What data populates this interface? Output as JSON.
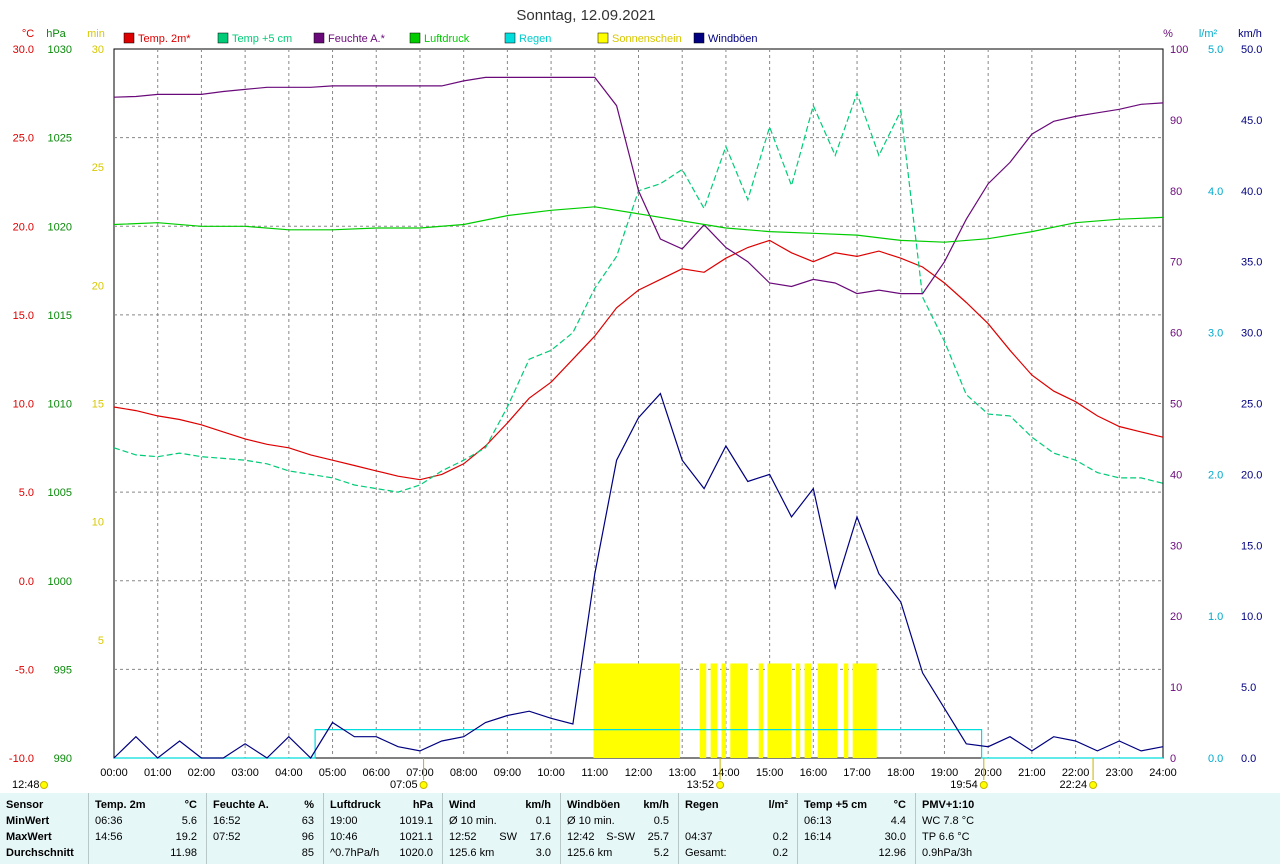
{
  "title": "Sonntag, 12.09.2021",
  "colors": {
    "temp2m": "#dd0000",
    "temp5cm": "#00cc77",
    "feuchte": "#6a0a7a",
    "luftdruck": "#00cc00",
    "regen": "#00dddd",
    "sonne": "#ffff00",
    "wind": "#000080",
    "grid": "#888888",
    "footer_bg": "#e6f7f8"
  },
  "legend": [
    {
      "key": "temp2m",
      "label": "Temp. 2m*"
    },
    {
      "key": "temp5cm",
      "label": "Temp +5 cm"
    },
    {
      "key": "feuchte",
      "label": "Feuchte A.*"
    },
    {
      "key": "luftdruck",
      "label": "Luftdruck"
    },
    {
      "key": "regen",
      "label": "Regen"
    },
    {
      "key": "sonne",
      "label": "Sonnenschein"
    },
    {
      "key": "wind",
      "label": "Windböen"
    }
  ],
  "axis_units": {
    "temp": "°C",
    "press": "hPa",
    "sun": "min",
    "hum": "%",
    "rain": "l/m²",
    "wind": "km/h"
  },
  "chart_data": {
    "type": "line",
    "title": "Sonntag, 12.09.2021",
    "xlim": [
      0,
      24
    ],
    "x_ticks": [
      "00:00",
      "01:00",
      "02:00",
      "03:00",
      "04:00",
      "05:00",
      "06:00",
      "07:00",
      "08:00",
      "09:00",
      "10:00",
      "11:00",
      "12:00",
      "13:00",
      "14:00",
      "15:00",
      "16:00",
      "17:00",
      "18:00",
      "19:00",
      "20:00",
      "21:00",
      "22:00",
      "23:00",
      "24:00"
    ],
    "grid": true,
    "axes": {
      "temp": {
        "ylim": [
          -10,
          30
        ],
        "ticks": [
          "30.0",
          "25.0",
          "20.0",
          "15.0",
          "10.0",
          "5.0",
          "0.0",
          "-5.0",
          "-10.0"
        ]
      },
      "press": {
        "ylim": [
          990,
          1030
        ],
        "ticks": [
          "1030",
          "1025",
          "1020",
          "1015",
          "1010",
          "1005",
          "1000",
          "995",
          "990"
        ]
      },
      "sun": {
        "ylim": [
          0,
          30
        ],
        "ticks": [
          "30",
          "25",
          "20",
          "15",
          "10",
          "5"
        ]
      },
      "hum": {
        "ylim": [
          0,
          100
        ],
        "ticks": [
          "100",
          "90",
          "80",
          "70",
          "60",
          "50",
          "40",
          "30",
          "20",
          "10",
          "0"
        ]
      },
      "rain": {
        "ylim": [
          0,
          5
        ],
        "ticks": [
          "5.0",
          "4.0",
          "3.0",
          "2.0",
          "1.0",
          "0.0"
        ]
      },
      "wind": {
        "ylim": [
          0,
          50
        ],
        "ticks": [
          "50.0",
          "45.0",
          "40.0",
          "35.0",
          "30.0",
          "25.0",
          "20.0",
          "15.0",
          "10.0",
          "5.0",
          "0.0"
        ]
      }
    },
    "series": [
      {
        "name": "Temp. 2m*",
        "axis": "temp",
        "x": [
          0,
          0.5,
          1,
          1.5,
          2,
          2.5,
          3,
          3.5,
          4,
          4.5,
          5,
          5.5,
          6,
          6.5,
          7,
          7.5,
          8,
          8.5,
          9,
          9.5,
          10,
          10.5,
          11,
          11.5,
          12,
          12.5,
          13,
          13.5,
          14,
          14.5,
          15,
          15.5,
          16,
          16.5,
          17,
          17.5,
          18,
          18.5,
          19,
          19.5,
          20,
          20.5,
          21,
          21.5,
          22,
          22.5,
          23,
          23.5,
          24
        ],
        "y": [
          9.8,
          9.6,
          9.3,
          9.1,
          8.8,
          8.4,
          8.0,
          7.7,
          7.5,
          7.1,
          6.8,
          6.5,
          6.2,
          5.9,
          5.7,
          6.0,
          6.6,
          7.6,
          8.9,
          10.3,
          11.2,
          12.5,
          13.8,
          15.4,
          16.4,
          17.0,
          17.6,
          17.4,
          18.2,
          18.8,
          19.2,
          18.5,
          18.0,
          18.5,
          18.3,
          18.6,
          18.2,
          17.7,
          16.8,
          15.7,
          14.5,
          13.0,
          11.6,
          10.7,
          10.1,
          9.3,
          8.7,
          8.4,
          8.1
        ]
      },
      {
        "name": "Temp +5 cm",
        "axis": "temp",
        "x": [
          0,
          0.5,
          1,
          1.5,
          2,
          2.5,
          3,
          3.5,
          4,
          4.5,
          5,
          5.5,
          6,
          6.5,
          7,
          7.5,
          8,
          8.5,
          9,
          9.5,
          10,
          10.5,
          11,
          11.5,
          12,
          12.5,
          13,
          13.5,
          14,
          14.5,
          15,
          15.5,
          16,
          16.5,
          17,
          17.5,
          18,
          18.5,
          19,
          19.5,
          20,
          20.5,
          21,
          21.5,
          22,
          22.5,
          23,
          23.5,
          24
        ],
        "y": [
          7.5,
          7.1,
          7.0,
          7.2,
          7.0,
          6.9,
          6.8,
          6.6,
          6.2,
          6.0,
          5.8,
          5.4,
          5.2,
          5.0,
          5.4,
          6.2,
          6.8,
          7.5,
          9.8,
          12.5,
          13.0,
          14.0,
          16.5,
          18.3,
          22.0,
          22.4,
          23.2,
          21.0,
          24.5,
          21.5,
          25.6,
          22.3,
          26.8,
          24.0,
          27.5,
          24.0,
          26.5,
          16.0,
          13.5,
          10.5,
          9.4,
          9.3,
          8.1,
          7.2,
          6.8,
          6.1,
          5.8,
          5.8,
          5.5
        ]
      },
      {
        "name": "Feuchte A.*",
        "axis": "hum",
        "x": [
          0,
          0.5,
          1,
          1.5,
          2,
          2.5,
          3,
          3.5,
          4,
          4.5,
          5,
          5.5,
          6,
          6.5,
          7,
          7.5,
          8,
          8.5,
          9,
          9.5,
          10,
          10.5,
          11,
          11.5,
          12,
          12.5,
          13,
          13.5,
          14,
          14.5,
          15,
          15.5,
          16,
          16.5,
          17,
          17.5,
          18,
          18.5,
          19,
          19.5,
          20,
          20.5,
          21,
          21.5,
          22,
          22.5,
          23,
          23.5,
          24
        ],
        "y": [
          93.2,
          93.3,
          93.6,
          93.6,
          93.6,
          94.0,
          94.3,
          94.6,
          94.6,
          94.6,
          94.8,
          94.8,
          94.8,
          94.8,
          94.8,
          94.8,
          95.5,
          96.0,
          96.0,
          96.0,
          96.0,
          96.0,
          96.0,
          92.0,
          80.0,
          73.2,
          71.8,
          75.2,
          72.0,
          70.0,
          67.0,
          66.5,
          67.5,
          67.0,
          65.5,
          66.0,
          65.5,
          65.5,
          70.0,
          76.0,
          81.0,
          84.0,
          88.0,
          89.8,
          90.5,
          91.0,
          91.5,
          92.2,
          92.4
        ]
      },
      {
        "name": "Luftdruck",
        "axis": "press",
        "x": [
          0,
          1,
          2,
          3,
          4,
          5,
          6,
          7,
          8,
          9,
          10,
          11,
          12,
          13,
          14,
          15,
          16,
          17,
          18,
          19,
          20,
          21,
          22,
          23,
          24
        ],
        "y": [
          1020.1,
          1020.2,
          1020.0,
          1020.0,
          1019.8,
          1019.8,
          1019.9,
          1019.9,
          1020.1,
          1020.6,
          1020.9,
          1021.1,
          1020.7,
          1020.3,
          1019.9,
          1019.7,
          1019.6,
          1019.5,
          1019.2,
          1019.1,
          1019.3,
          1019.7,
          1020.2,
          1020.4,
          1020.5
        ]
      },
      {
        "name": "Regen",
        "axis": "rain",
        "x": [
          0,
          4.6,
          4.6,
          19.85,
          19.85,
          24
        ],
        "y": [
          0,
          0,
          0.2,
          0.2,
          0,
          0
        ]
      },
      {
        "name": "Windböen",
        "axis": "wind",
        "x": [
          0,
          0.5,
          1,
          1.5,
          2,
          2.5,
          3,
          3.5,
          4,
          4.5,
          5,
          5.5,
          6,
          6.5,
          7,
          7.5,
          8,
          8.5,
          9,
          9.5,
          10,
          10.5,
          11,
          11.5,
          12,
          12.5,
          13,
          13.5,
          14,
          14.5,
          15,
          15.5,
          16,
          16.5,
          17,
          17.5,
          18,
          18.5,
          19,
          19.5,
          20,
          20.5,
          21,
          21.5,
          22,
          22.5,
          23,
          23.5,
          24
        ],
        "y": [
          0,
          1.5,
          0,
          1.2,
          0,
          0,
          1,
          0,
          1.5,
          0,
          2.5,
          1.5,
          1.5,
          0.8,
          0.5,
          1.2,
          1.5,
          2.5,
          3,
          3.3,
          2.8,
          2.4,
          13,
          21,
          24,
          25.7,
          21,
          19,
          22,
          19.5,
          20,
          17,
          19,
          12,
          17,
          13,
          11,
          6,
          3.5,
          1,
          0.8,
          1.5,
          0.5,
          1.5,
          1.2,
          0.5,
          1.2,
          0.5,
          0.8
        ]
      }
    ],
    "sunshine_intervals": [
      [
        10.97,
        12.95
      ],
      [
        13.4,
        13.55
      ],
      [
        13.65,
        13.8
      ],
      [
        13.9,
        14.0
      ],
      [
        14.1,
        14.5
      ],
      [
        14.75,
        14.85
      ],
      [
        14.95,
        15.5
      ],
      [
        15.6,
        15.7
      ],
      [
        15.8,
        15.95
      ],
      [
        16.1,
        16.55
      ],
      [
        16.7,
        16.8
      ],
      [
        16.9,
        17.45
      ]
    ],
    "markers": [
      {
        "label": "07:05",
        "x": 7.083
      },
      {
        "label": "13:52",
        "x": 13.867
      },
      {
        "label": "19:54",
        "x": 19.9
      },
      {
        "label": "22:24",
        "x": 22.4
      },
      {
        "label": "12:48",
        "x": 12.8
      }
    ]
  },
  "footer": {
    "columns": [
      {
        "head": "Sensor",
        "unit": "",
        "rows": [
          [
            "MinWert",
            "",
            ""
          ],
          [
            "MaxWert",
            "",
            ""
          ],
          [
            "Durchschnitt",
            "",
            ""
          ]
        ]
      },
      {
        "head": "Temp. 2m",
        "unit": "°C",
        "rows": [
          [
            "06:36",
            "",
            "5.6"
          ],
          [
            "14:56",
            "",
            "19.2"
          ],
          [
            "",
            "",
            "11.98"
          ]
        ]
      },
      {
        "head": "Feuchte A.",
        "unit": "%",
        "rows": [
          [
            "16:52",
            "",
            "63"
          ],
          [
            "07:52",
            "",
            "96"
          ],
          [
            "",
            "",
            "85"
          ]
        ]
      },
      {
        "head": "Luftdruck",
        "unit": "hPa",
        "rows": [
          [
            "19:00",
            "",
            "1019.1"
          ],
          [
            "10:46",
            "",
            "1021.1"
          ],
          [
            "^0.7hPa/h",
            "",
            "1020.0"
          ]
        ]
      },
      {
        "head": "Wind",
        "unit": "km/h",
        "rows": [
          [
            "Ø 10 min.",
            "",
            "0.1"
          ],
          [
            "12:52",
            "SW",
            "17.6"
          ],
          [
            "125.6 km",
            "",
            "3.0"
          ]
        ]
      },
      {
        "head": "Windböen",
        "unit": "km/h",
        "rows": [
          [
            "Ø 10 min.",
            "",
            "0.5"
          ],
          [
            "12:42",
            "S-SW",
            "25.7"
          ],
          [
            "125.6 km",
            "",
            "5.2"
          ]
        ]
      },
      {
        "head": "Regen",
        "unit": "l/m²",
        "rows": [
          [
            "",
            "",
            ""
          ],
          [
            "04:37",
            "",
            "0.2"
          ],
          [
            "Gesamt:",
            "",
            "0.2"
          ]
        ]
      },
      {
        "head": "Temp +5 cm",
        "unit": "°C",
        "rows": [
          [
            "06:13",
            "",
            "4.4"
          ],
          [
            "16:14",
            "",
            "30.0"
          ],
          [
            "",
            "",
            "12.96"
          ]
        ]
      },
      {
        "head": "PMV+1:10",
        "unit": "",
        "rows": [
          [
            "WC 7.8 °C",
            "",
            ""
          ],
          [
            "TP 6.6 °C",
            "",
            ""
          ],
          [
            "0.9hPa/3h",
            "",
            ""
          ]
        ]
      }
    ]
  }
}
